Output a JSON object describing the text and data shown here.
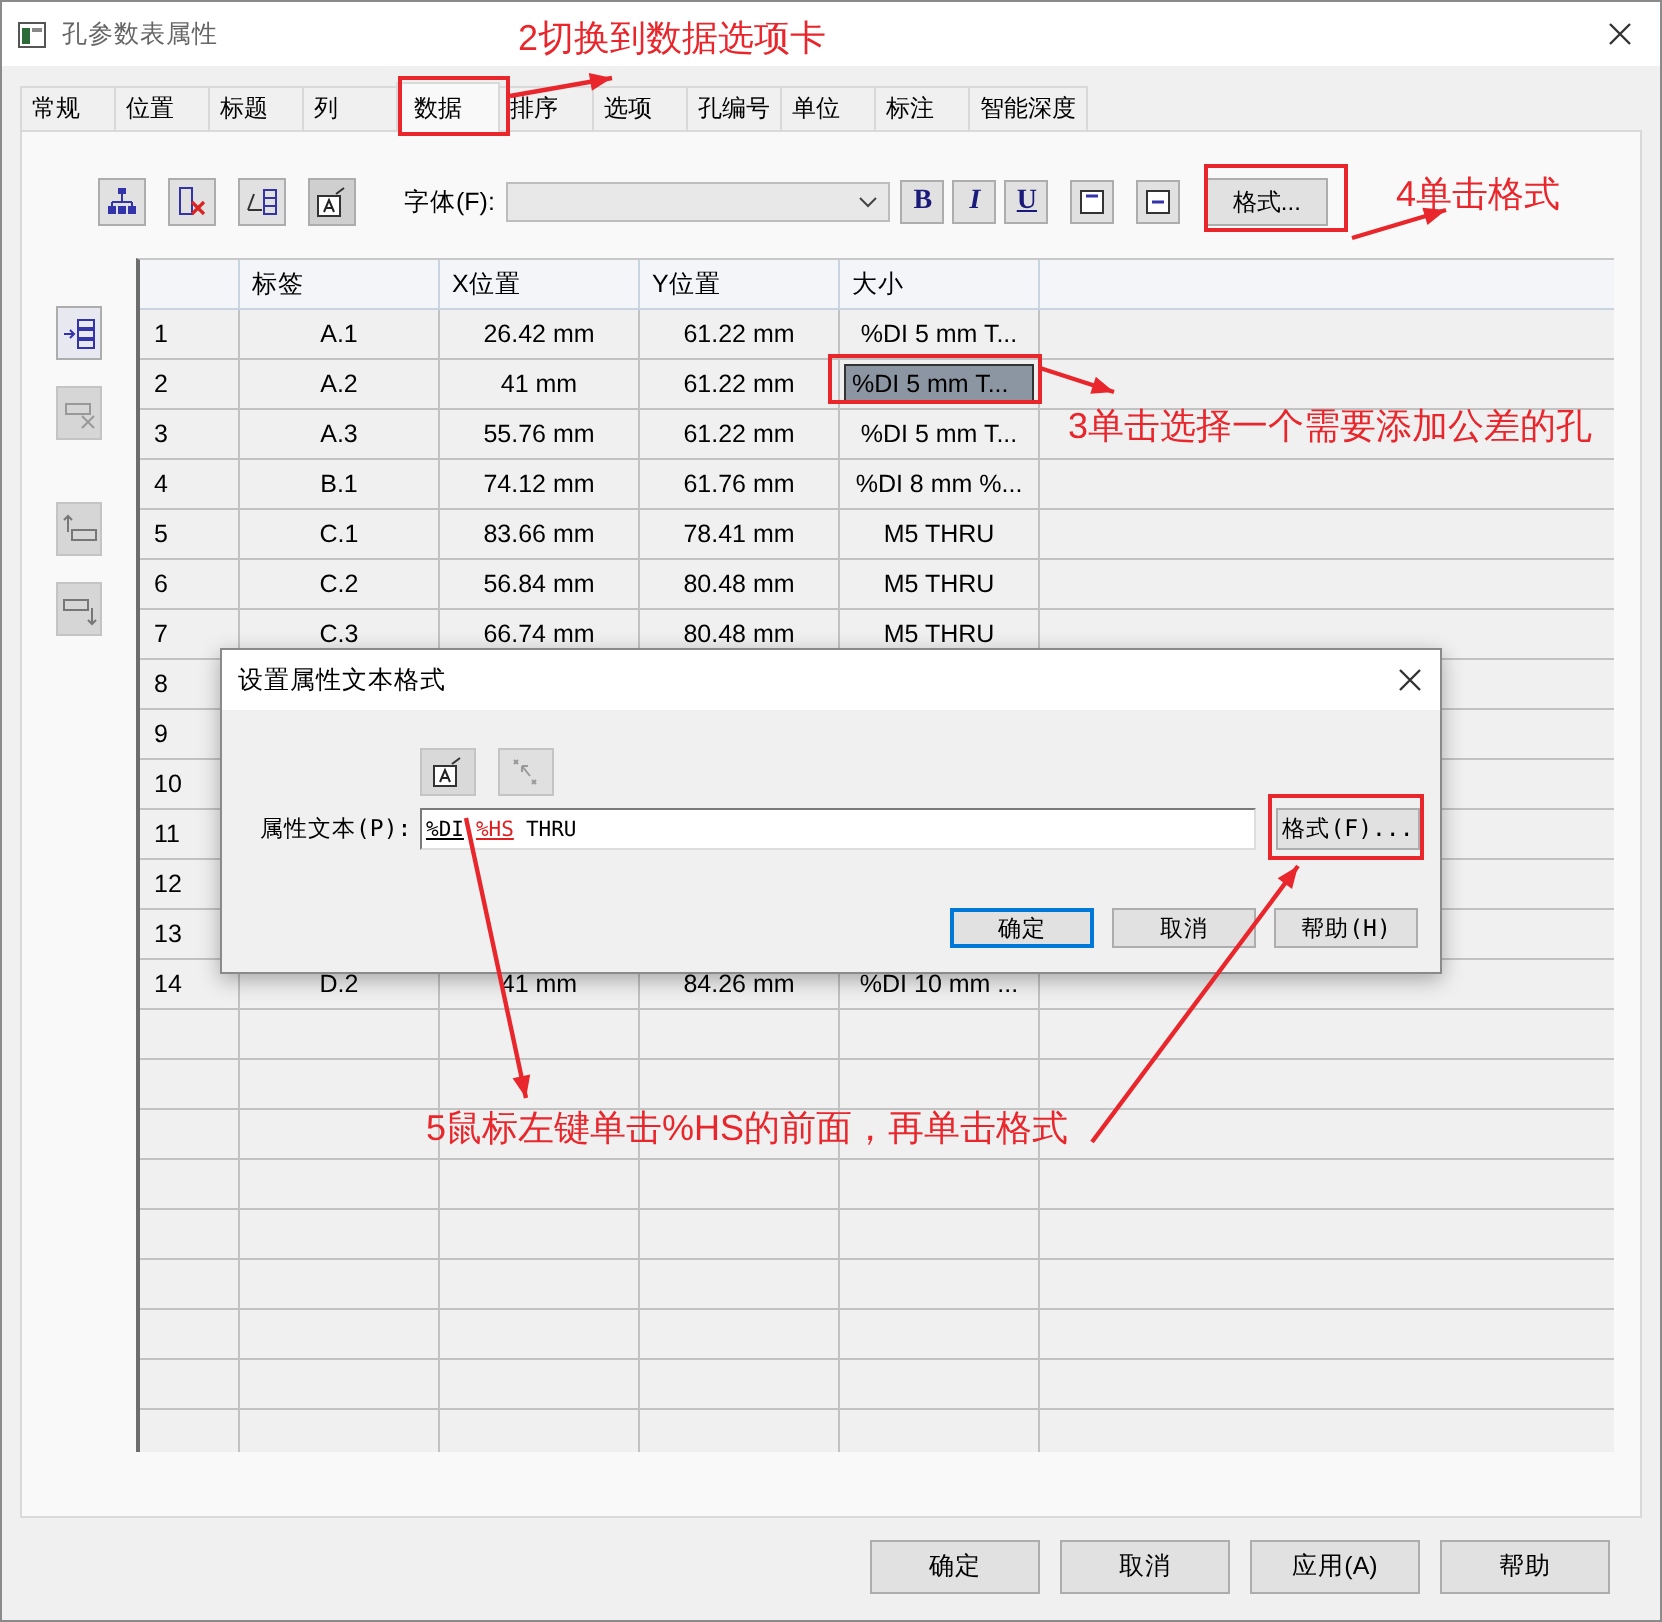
{
  "window": {
    "title": "孔参数表属性"
  },
  "tabs": [
    {
      "label": "常规",
      "selected": false
    },
    {
      "label": "位置",
      "selected": false
    },
    {
      "label": "标题",
      "selected": false
    },
    {
      "label": "列",
      "selected": false
    },
    {
      "label": "数据",
      "selected": true
    },
    {
      "label": "排序",
      "selected": false
    },
    {
      "label": "选项",
      "selected": false
    },
    {
      "label": "孔编号",
      "selected": false
    },
    {
      "label": "单位",
      "selected": false
    },
    {
      "label": "标注",
      "selected": false
    },
    {
      "label": "智能深度",
      "selected": false
    }
  ],
  "toolbar": {
    "tools": [
      {
        "kind": "tree"
      },
      {
        "kind": "delete"
      },
      {
        "kind": "columns"
      },
      {
        "kind": "text"
      }
    ],
    "font_label": "字体(F):",
    "style_buttons": [
      {
        "label": "B",
        "kind": "bold"
      },
      {
        "label": "I",
        "kind": "italic"
      },
      {
        "label": "U",
        "kind": "underline"
      }
    ],
    "align_tools": [
      {
        "kind": "top"
      },
      {
        "kind": "middle"
      }
    ],
    "format_button": "格式..."
  },
  "side_tools": [
    {
      "kind": "insert",
      "disabled": false
    },
    {
      "kind": "remove",
      "disabled": true
    },
    {
      "kind": "up",
      "disabled": true
    },
    {
      "kind": "down",
      "disabled": true
    }
  ],
  "table": {
    "columns": [
      "标签",
      "X位置",
      "Y位置",
      "大小"
    ],
    "rows": [
      {
        "index": "1",
        "cells": [
          "A.1",
          "26.42 mm",
          "61.22 mm",
          "%DI 5 mm T..."
        ],
        "selected": false
      },
      {
        "index": "2",
        "cells": [
          "A.2",
          "41 mm",
          "61.22 mm",
          "%DI 5 mm T..."
        ],
        "selected": true
      },
      {
        "index": "3",
        "cells": [
          "A.3",
          "55.76 mm",
          "61.22 mm",
          "%DI 5 mm T..."
        ],
        "selected": false
      },
      {
        "index": "4",
        "cells": [
          "B.1",
          "74.12 mm",
          "61.76 mm",
          "%DI 8 mm %..."
        ],
        "selected": false
      },
      {
        "index": "5",
        "cells": [
          "C.1",
          "83.66 mm",
          "78.41 mm",
          "M5 THRU"
        ],
        "selected": false
      },
      {
        "index": "6",
        "cells": [
          "C.2",
          "56.84 mm",
          "80.48 mm",
          "M5 THRU"
        ],
        "selected": false
      },
      {
        "index": "7",
        "cells": [
          "C.3",
          "66.74 mm",
          "80.48 mm",
          "M5 THRU"
        ],
        "selected": false
      },
      {
        "index": "8"
      },
      {
        "index": "9"
      },
      {
        "index": "10"
      },
      {
        "index": "11"
      },
      {
        "index": "12"
      },
      {
        "index": "13"
      },
      {
        "index": "14",
        "cells": [
          "D.2",
          "41 mm",
          "84.26 mm",
          "%DI 10 mm ..."
        ],
        "selected": false
      }
    ]
  },
  "dialog": {
    "title": "设置属性文本格式",
    "tools": [
      {
        "kind": "text",
        "disabled": false
      },
      {
        "kind": "reset",
        "disabled": true
      }
    ],
    "field_label": "属性文本(P):",
    "segments": [
      {
        "text": "%DI",
        "kind": "field"
      },
      {
        "text": "%HS",
        "kind": "active_field"
      },
      {
        "text": "THRU",
        "kind": "plain"
      }
    ],
    "format_button": "格式(F)...",
    "buttons": [
      {
        "label": "确定",
        "default": true
      },
      {
        "label": "取消",
        "default": false
      },
      {
        "label": "帮助(H)",
        "default": false
      }
    ]
  },
  "buttons": [
    "确定",
    "取消",
    "应用(A)",
    "帮助"
  ],
  "annotations": [
    {
      "text": "2切换到数据选项卡"
    },
    {
      "text": "4单击格式"
    },
    {
      "text": "3单击选择一个需要添加公差的孔"
    },
    {
      "text": "5鼠标左键单击%HS的前面，再单击格式"
    }
  ]
}
